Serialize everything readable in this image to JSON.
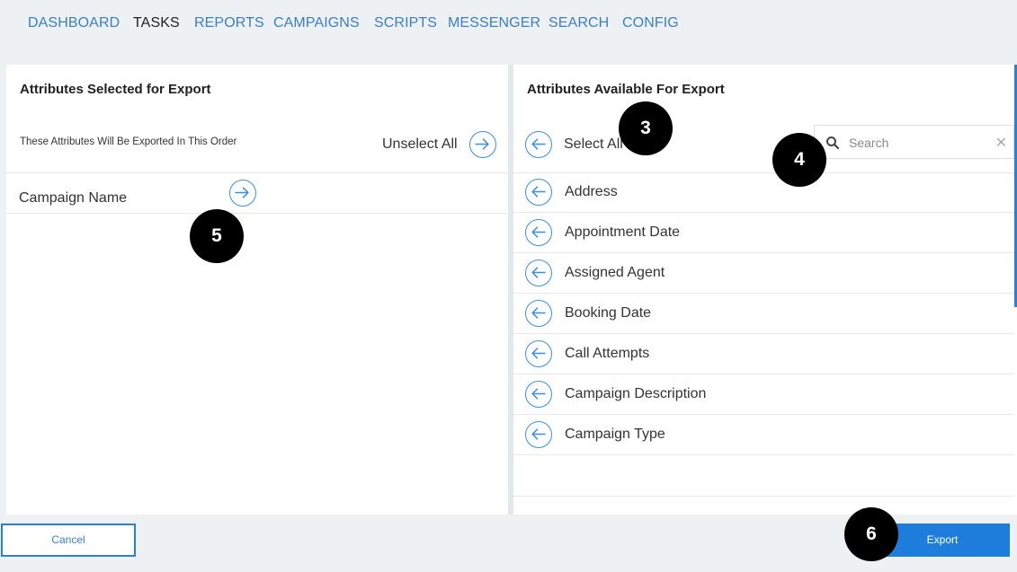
{
  "nav": {
    "items": [
      {
        "label": "DASHBOARD",
        "active": false
      },
      {
        "label": "TASKS",
        "active": true
      },
      {
        "label": "REPORTS",
        "active": false
      },
      {
        "label": "CAMPAIGNS",
        "active": false
      },
      {
        "label": "SCRIPTS",
        "active": false
      },
      {
        "label": "MESSENGER",
        "active": false
      },
      {
        "label": "SEARCH",
        "active": false
      },
      {
        "label": "CONFIG",
        "active": false
      }
    ]
  },
  "selected_panel": {
    "title": "Attributes Selected for Export",
    "order_note": "These Attributes Will Be Exported In This Order",
    "unselect_all_label": "Unselect All",
    "items": [
      "Campaign Name"
    ]
  },
  "available_panel": {
    "title": "Attributes Available For Export",
    "select_all_label": "Select All",
    "search_placeholder": "Search",
    "items": [
      "Address",
      "Appointment Date",
      "Assigned Agent",
      "Booking Date",
      "Call Attempts",
      "Campaign Description",
      "Campaign Type"
    ]
  },
  "footer": {
    "cancel_label": "Cancel",
    "export_label": "Export"
  },
  "badges": [
    "3",
    "4",
    "5",
    "6"
  ],
  "colors": {
    "accent": "#1e7ddb",
    "nav_link": "#3b7fc4",
    "background": "#edf1f4"
  }
}
